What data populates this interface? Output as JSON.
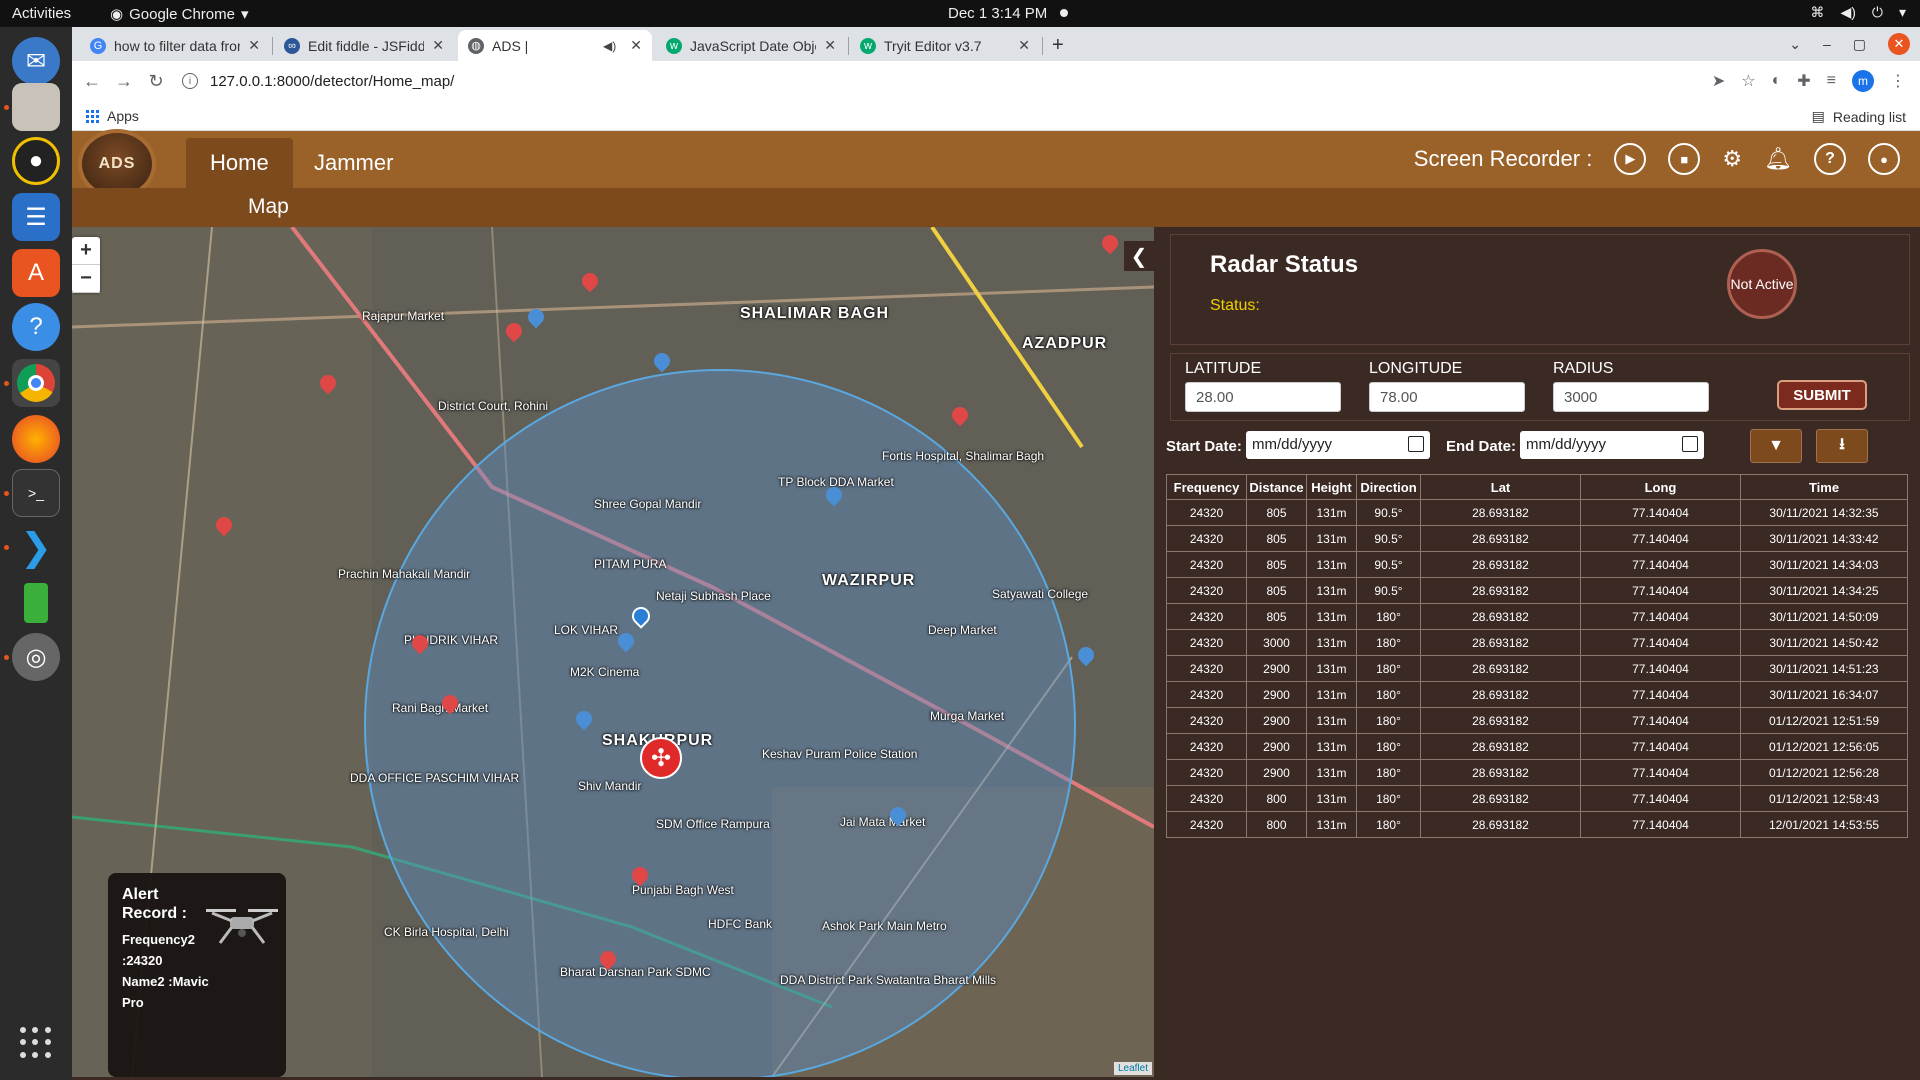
{
  "os": {
    "activities": "Activities",
    "app_name": "Google Chrome",
    "clock": "Dec 1  3:14 PM"
  },
  "browser": {
    "tabs": [
      {
        "title": "how to filter data from st",
        "icon_color": "#4285f4"
      },
      {
        "title": "Edit fiddle - JSFiddle - Coc",
        "icon_color": "#2b5797"
      },
      {
        "title": "ADS |",
        "icon_color": "#5f6368"
      },
      {
        "title": "JavaScript Date Objects",
        "icon_color": "#04aa6d"
      },
      {
        "title": "Tryit Editor v3.7",
        "icon_color": "#04aa6d"
      }
    ],
    "url": "127.0.0.1:8000/detector/Home_map/",
    "profile_initial": "m",
    "bookmarks_apps": "Apps",
    "reading_list": "Reading list"
  },
  "app": {
    "logo_text": "ADS",
    "nav": {
      "home": "Home",
      "jammer": "Jammer"
    },
    "subnav": "Map",
    "recorder_label": "Screen Recorder :"
  },
  "map": {
    "attribution": "Leaflet",
    "labels": [
      {
        "text": "SHALIMAR BAGH",
        "big": true
      },
      {
        "text": "AZADPUR",
        "big": true
      },
      {
        "text": "WAZIRPUR",
        "big": true
      },
      {
        "text": "SHAKURPUR",
        "big": true
      },
      {
        "text": "PITAM PURA",
        "big": false
      },
      {
        "text": "Rajapur Market",
        "big": false
      },
      {
        "text": "District Court, Rohini",
        "big": false
      },
      {
        "text": "Netaji Subhash Place",
        "big": false
      },
      {
        "text": "LOK VIHAR",
        "big": false
      },
      {
        "text": "PUNDRIK VIHAR",
        "big": false
      },
      {
        "text": "Rani Bagh Market",
        "big": false
      },
      {
        "text": "Shiv Mandir",
        "big": false
      },
      {
        "text": "Keshav Puram Police Station",
        "big": false
      },
      {
        "text": "Jai Mata Market",
        "big": false
      },
      {
        "text": "SDM Office Rampura",
        "big": false
      },
      {
        "text": "DDA OFFICE PASCHIM VIHAR",
        "big": false
      },
      {
        "text": "Punjabi Bagh West",
        "big": false
      },
      {
        "text": "HDFC Bank",
        "big": false
      },
      {
        "text": "Deep Market",
        "big": false
      },
      {
        "text": "Satyawati College",
        "big": false
      },
      {
        "text": "Prachin Mahakali Mandir",
        "big": false
      },
      {
        "text": "Fortis Hospital, Shalimar Bagh",
        "big": false
      },
      {
        "text": "TP Block DDA Market",
        "big": false
      },
      {
        "text": "Shree Gopal Mandir",
        "big": false
      },
      {
        "text": "M2K Cinema",
        "big": false
      },
      {
        "text": "Murga Market",
        "big": false
      },
      {
        "text": "CK Birla Hospital, Delhi",
        "big": false
      },
      {
        "text": "Bharat Darshan Park SDMC",
        "big": false
      },
      {
        "text": "Ashok Park Main Metro",
        "big": false
      },
      {
        "text": "DDA District Park Swatantra Bharat Mills",
        "big": false
      }
    ]
  },
  "alert": {
    "title": "Alert Record :",
    "frequency": "Frequency2 :24320",
    "name": "Name2 :Mavic Pro"
  },
  "radar": {
    "title": "Radar Status",
    "status_label": "Status:",
    "badge": "Not Active"
  },
  "coords": {
    "latitude_label": "LATITUDE",
    "latitude": "28.00",
    "longitude_label": "LONGITUDE",
    "longitude": "78.00",
    "radius_label": "RADIUS",
    "radius": "3000",
    "submit": "SUBMIT"
  },
  "filter": {
    "start_label": "Start Date:",
    "start_placeholder": "mm/dd/yyyy",
    "end_label": "End Date:",
    "end_placeholder": "mm/dd/yyyy"
  },
  "table": {
    "headers": [
      "Frequency",
      "Distance",
      "Height",
      "Direction",
      "Lat",
      "Long",
      "Time"
    ],
    "rows": [
      [
        "24320",
        "805",
        "131m",
        "90.5°",
        "28.693182",
        "77.140404",
        "30/11/2021 14:32:35"
      ],
      [
        "24320",
        "805",
        "131m",
        "90.5°",
        "28.693182",
        "77.140404",
        "30/11/2021 14:33:42"
      ],
      [
        "24320",
        "805",
        "131m",
        "90.5°",
        "28.693182",
        "77.140404",
        "30/11/2021 14:34:03"
      ],
      [
        "24320",
        "805",
        "131m",
        "90.5°",
        "28.693182",
        "77.140404",
        "30/11/2021 14:34:25"
      ],
      [
        "24320",
        "805",
        "131m",
        "180°",
        "28.693182",
        "77.140404",
        "30/11/2021 14:50:09"
      ],
      [
        "24320",
        "3000",
        "131m",
        "180°",
        "28.693182",
        "77.140404",
        "30/11/2021 14:50:42"
      ],
      [
        "24320",
        "2900",
        "131m",
        "180°",
        "28.693182",
        "77.140404",
        "30/11/2021 14:51:23"
      ],
      [
        "24320",
        "2900",
        "131m",
        "180°",
        "28.693182",
        "77.140404",
        "30/11/2021 16:34:07"
      ],
      [
        "24320",
        "2900",
        "131m",
        "180°",
        "28.693182",
        "77.140404",
        "01/12/2021 12:51:59"
      ],
      [
        "24320",
        "2900",
        "131m",
        "180°",
        "28.693182",
        "77.140404",
        "01/12/2021 12:56:05"
      ],
      [
        "24320",
        "2900",
        "131m",
        "180°",
        "28.693182",
        "77.140404",
        "01/12/2021 12:56:28"
      ],
      [
        "24320",
        "800",
        "131m",
        "180°",
        "28.693182",
        "77.140404",
        "01/12/2021 12:58:43"
      ],
      [
        "24320",
        "800",
        "131m",
        "180°",
        "28.693182",
        "77.140404",
        "12/01/2021 14:53:55"
      ]
    ]
  },
  "colors": {
    "header": "#9a6128",
    "subnav": "#7d4a1e",
    "panel": "#3b2a24",
    "status": "#f0d000",
    "radius_circle": "#5aa8e0"
  }
}
